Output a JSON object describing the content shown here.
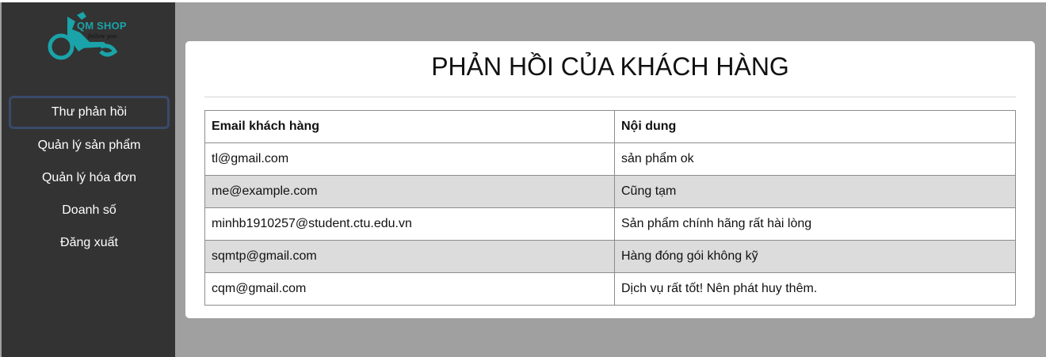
{
  "brand": {
    "name": "QM SHOP",
    "tagline": "follow you",
    "accent_color": "#1aa3a8"
  },
  "sidebar": {
    "items": [
      {
        "label": "Thư phản hồi",
        "active": true
      },
      {
        "label": "Quản lý sản phẩm",
        "active": false
      },
      {
        "label": "Quản lý hóa đơn",
        "active": false
      },
      {
        "label": "Doanh số",
        "active": false
      },
      {
        "label": "Đăng xuất",
        "active": false
      }
    ]
  },
  "main": {
    "title": "PHẢN HỒI CỦA KHÁCH HÀNG",
    "table": {
      "headers": [
        "Email khách hàng",
        "Nội dung"
      ],
      "rows": [
        [
          "tl@gmail.com",
          "sản phẩm ok"
        ],
        [
          "me@example.com",
          "Cũng tạm"
        ],
        [
          "minhb1910257@student.ctu.edu.vn",
          "Sản phẩm chính hãng rất hài lòng"
        ],
        [
          "sqmtp@gmail.com",
          "Hàng đóng gói không kỹ"
        ],
        [
          "cqm@gmail.com",
          "Dịch vụ rất tốt! Nên phát huy thêm."
        ]
      ]
    }
  }
}
